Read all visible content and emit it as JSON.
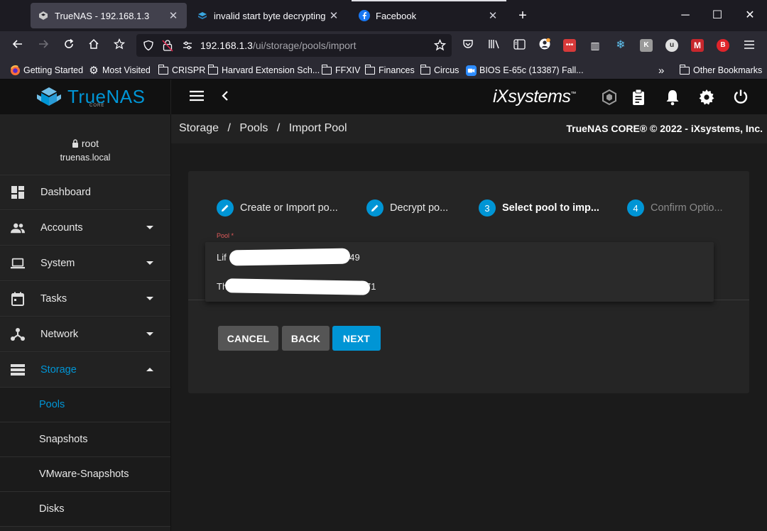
{
  "browser": {
    "tabs": [
      {
        "title": "TrueNAS - 192.168.1.3",
        "active": true
      },
      {
        "title": "invalid start byte decrypting poo",
        "active": false
      },
      {
        "title": "Facebook",
        "active": false
      }
    ],
    "new_tab_label": "+",
    "url_host": "192.168.1.3",
    "url_path": "/ui/storage/pools/import",
    "bookmarks": [
      {
        "label": "Getting Started",
        "icon": "firefox-icon"
      },
      {
        "label": "Most Visited",
        "icon": "gear-icon"
      },
      {
        "label": "CRISPR",
        "icon": "folder-icon"
      },
      {
        "label": "Harvard Extension Sch...",
        "icon": "folder-icon"
      },
      {
        "label": "FFXIV",
        "icon": "folder-icon"
      },
      {
        "label": "Finances",
        "icon": "folder-icon"
      },
      {
        "label": "Circus",
        "icon": "folder-icon"
      },
      {
        "label": "BIOS E-65c (13387) Fall...",
        "icon": "zoom-icon"
      }
    ],
    "other_bookmarks": "Other Bookmarks"
  },
  "app": {
    "logo_text": "TrueNAS",
    "logo_sub": "CORE",
    "brand": "iXsystems",
    "user": {
      "name": "root",
      "host": "truenas.local"
    },
    "nav": [
      {
        "label": "Dashboard",
        "icon": "dashboard-icon",
        "expandable": false
      },
      {
        "label": "Accounts",
        "icon": "accounts-icon",
        "expandable": true
      },
      {
        "label": "System",
        "icon": "laptop-icon",
        "expandable": true
      },
      {
        "label": "Tasks",
        "icon": "calendar-icon",
        "expandable": true
      },
      {
        "label": "Network",
        "icon": "network-icon",
        "expandable": true
      },
      {
        "label": "Storage",
        "icon": "storage-icon",
        "expandable": true,
        "expanded": true
      }
    ],
    "storage_sub": [
      "Pools",
      "Snapshots",
      "VMware-Snapshots",
      "Disks"
    ],
    "active_sub": "Pools",
    "breadcrumb": [
      "Storage",
      "Pools",
      "Import Pool"
    ],
    "breadcrumb_sep": "/",
    "copyright": "TrueNAS CORE® © 2022 - iXsystems, Inc.",
    "steps": [
      {
        "num": "",
        "label": "Create or Import po...",
        "state": "done"
      },
      {
        "num": "",
        "label": "Decrypt po...",
        "state": "done"
      },
      {
        "num": "3",
        "label": "Select pool to imp...",
        "state": "current"
      },
      {
        "num": "4",
        "label": "Confirm Optio...",
        "state": "pending"
      }
    ],
    "pool_field_label": "Pool *",
    "pool_options": [
      {
        "prefix": "Lif",
        "suffix": "749"
      },
      {
        "prefix": "Th",
        "suffix": "71"
      }
    ],
    "buttons": {
      "cancel": "CANCEL",
      "back": "BACK",
      "next": "NEXT"
    },
    "colors": {
      "accent": "#0095d5",
      "header": "#111111",
      "sidebar": "#222222",
      "card": "#252525"
    }
  }
}
